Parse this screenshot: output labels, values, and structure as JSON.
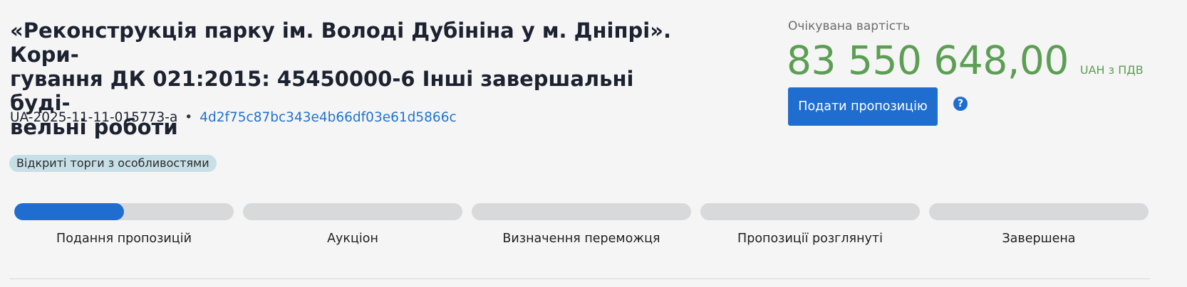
{
  "tender": {
    "title": "«Реконструкція парку ім. Володі Дубініна у м. Дніпрі». Кори-\nгування ДК 021:2015: 45450000-6 Інші завершальні буді-\nвельні роботи",
    "id": "UA-2025-11-11-015773-a",
    "separator": "•",
    "hash": "4d2f75c87bc343e4b66df03e61d5866c",
    "procedure_badge": "Відкриті торги з особливостями"
  },
  "price": {
    "caption": "Очікувана вартість",
    "value": "83 550 648,00",
    "currency": "UAH з ПДВ"
  },
  "actions": {
    "submit_label": "Подати пропозицію",
    "help_symbol": "?"
  },
  "stages": [
    {
      "label": "Подання пропозицій",
      "progress": 0.5
    },
    {
      "label": "Аукціон",
      "progress": 0
    },
    {
      "label": "Визначення переможця",
      "progress": 0
    },
    {
      "label": "Пропозиції розглянуті",
      "progress": 0
    },
    {
      "label": "Завершена",
      "progress": 0
    }
  ],
  "colors": {
    "accent": "#1f6ecf",
    "price": "#5c9f54",
    "link": "#2173cf",
    "badge_bg": "#c7dfe6",
    "track": "#d8d9db"
  }
}
